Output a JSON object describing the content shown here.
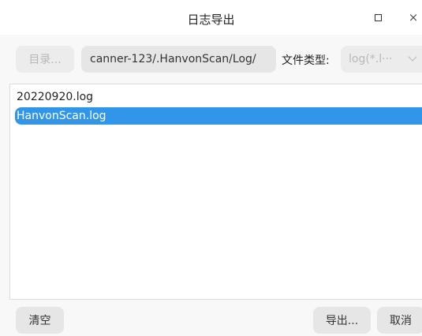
{
  "window": {
    "title": "日志导出",
    "maximize_label": "maximize",
    "close_glyph": "×"
  },
  "toolbar": {
    "directory_button": "目录...",
    "path_value": "canner-123/.HanvonScan/Log/",
    "file_type_label": "文件类型:",
    "file_type_value": "log(*.l···"
  },
  "file_list": {
    "items": [
      {
        "name": "20220920.log",
        "selected": false
      },
      {
        "name": "HanvonScan.log",
        "selected": true
      }
    ]
  },
  "footer": {
    "clear_button": "清空",
    "export_button": "导出...",
    "cancel_button": "取消"
  },
  "colors": {
    "selection": "#3296e8",
    "button_bg": "#e6e6e6",
    "disabled_text": "#b8b8b8"
  }
}
